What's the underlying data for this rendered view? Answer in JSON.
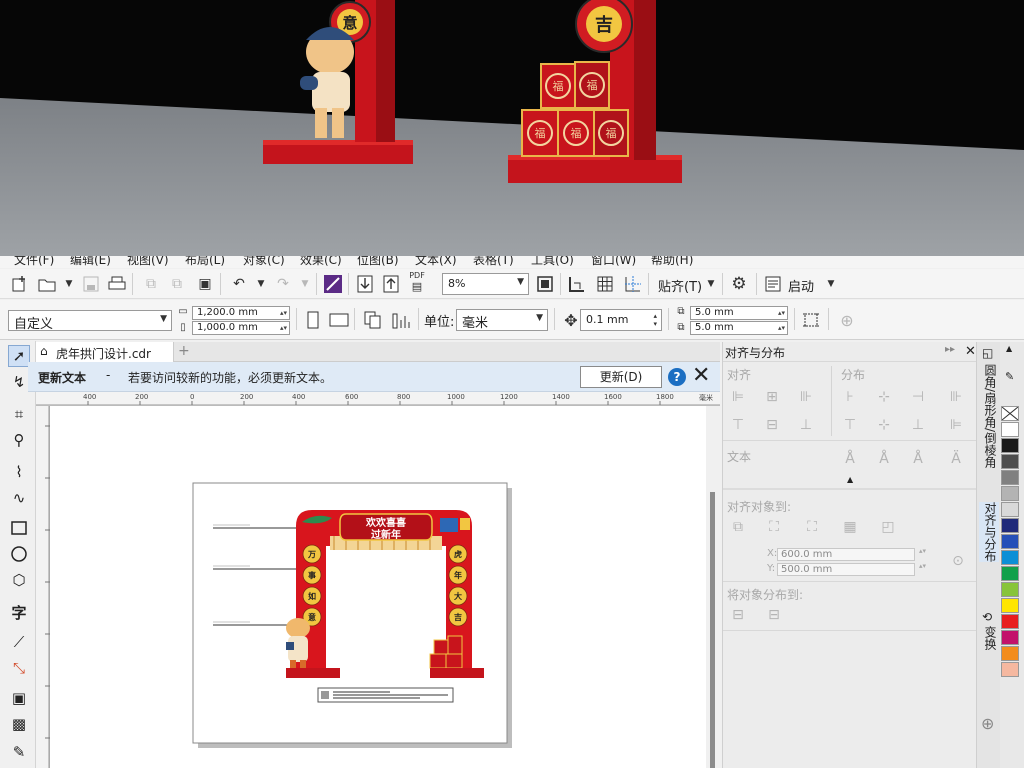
{
  "menu": [
    "文件(F)",
    "编辑(E)",
    "视图(V)",
    "布局(L)",
    "对象(C)",
    "效果(C)",
    "位图(B)",
    "文本(X)",
    "表格(T)",
    "工具(O)",
    "窗口(W)",
    "帮助(H)"
  ],
  "toolbar": {
    "pdf_label": "PDF",
    "zoom_value": "8%",
    "snap_label": "贴齐(T)",
    "launch_label": "启动"
  },
  "propertybar": {
    "page_preset": "自定义",
    "width_value": "1,200.0 mm",
    "height_value": "1,000.0 mm",
    "unit_label": "单位:",
    "unit_value": "毫米",
    "nudge_value": "0.1 mm",
    "dup_x": "5.0 mm",
    "dup_y": "5.0 mm"
  },
  "document": {
    "tab_title": "虎年拱门设计.cdr",
    "add_tab": "+"
  },
  "notification": {
    "title": "更新文本",
    "dash": "-",
    "message": "若要访问较新的功能，必须更新文本。",
    "button": "更新(D)",
    "help": "?"
  },
  "ruler": {
    "ticks": [
      "400",
      "200",
      "0",
      "200",
      "400",
      "600",
      "800",
      "1000",
      "1200",
      "1400",
      "1600",
      "1800"
    ],
    "unit": "毫米"
  },
  "docker": {
    "title": "对齐与分布",
    "section_align": "对齐",
    "section_distribute": "分布",
    "section_text": "文本",
    "section_align_to": "对齐对象到:",
    "x_label": "X:",
    "x_value": "600.0 mm",
    "y_label": "Y:",
    "y_value": "500.0 mm",
    "section_distribute_to": "将对象分布到:"
  },
  "vertical_tabs": [
    "圆角/扇形角/倒棱角",
    "对齐与分布",
    "变换"
  ],
  "artwork": {
    "banner_line1": "欢欢喜喜",
    "banner_line2": "过新年",
    "left_pillar": [
      "万",
      "事",
      "如",
      "意"
    ],
    "right_pillar": [
      "虎",
      "年",
      "大",
      "吉"
    ],
    "scene_left_char": "意",
    "scene_right_char": "吉",
    "scene_block_char": "福"
  },
  "palette": [
    "#ffffff",
    "#1a1a1a",
    "#4d4d4d",
    "#808080",
    "#b3b3b3",
    "#d9d9d9",
    "#1f2a7a",
    "#2550b8",
    "#0b8fd6",
    "#12a04a",
    "#88c43a",
    "#ffe600",
    "#e81e1e",
    "#c2126a",
    "#f28c1c",
    "#f5b8a0"
  ]
}
